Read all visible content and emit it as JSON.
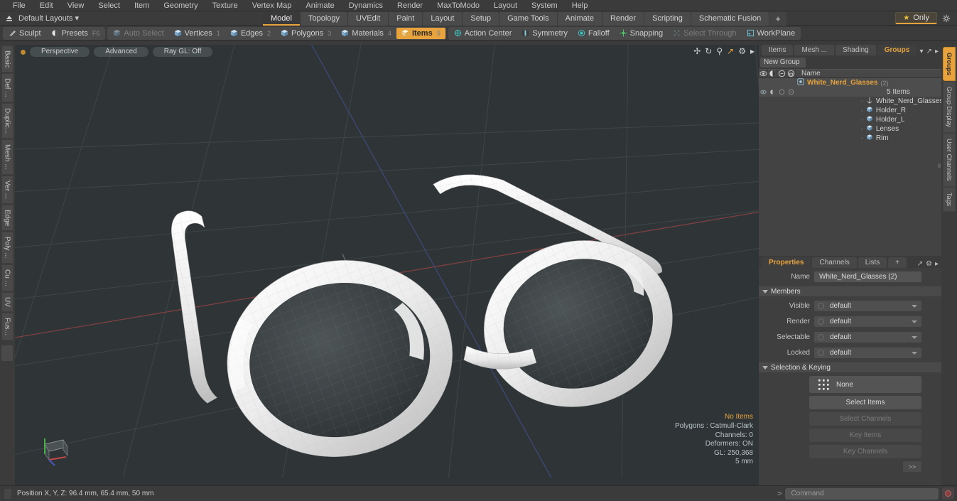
{
  "menubar": {
    "items": [
      "File",
      "Edit",
      "View",
      "Select",
      "Item",
      "Geometry",
      "Texture",
      "Vertex Map",
      "Animate",
      "Dynamics",
      "Render",
      "MaxToModo",
      "Layout",
      "System",
      "Help"
    ]
  },
  "layout_row": {
    "default_layouts_label": "Default Layouts ▾",
    "tabs": [
      {
        "label": "Model",
        "active": true
      },
      {
        "label": "Topology",
        "active": false
      },
      {
        "label": "UVEdit",
        "active": false
      },
      {
        "label": "Paint",
        "active": false
      },
      {
        "label": "Layout",
        "active": false
      },
      {
        "label": "Setup",
        "active": false
      },
      {
        "label": "Game Tools",
        "active": false
      },
      {
        "label": "Animate",
        "active": false
      },
      {
        "label": "Render",
        "active": false
      },
      {
        "label": "Scripting",
        "active": false
      },
      {
        "label": "Schematic Fusion",
        "active": false
      }
    ],
    "add_tab_label": "+",
    "only_label": "Only",
    "star_icon": "star-icon",
    "gear_icon": "gear-icon"
  },
  "mode_toolbar": {
    "group1": [
      {
        "label": "Sculpt",
        "icon": "brush-icon",
        "state": "normal"
      },
      {
        "label": "Presets",
        "icon": "sphere-icon",
        "state": "normal",
        "hotkey": "F6"
      }
    ],
    "group2": [
      {
        "label": "Auto Select",
        "icon": "cube-icon",
        "state": "dim"
      },
      {
        "label": "Vertices",
        "icon": "cube-icon",
        "state": "normal",
        "num": "1"
      },
      {
        "label": "Edges",
        "icon": "cube-icon",
        "state": "normal",
        "num": "2"
      },
      {
        "label": "Polygons",
        "icon": "cube-icon",
        "state": "normal",
        "num": "3"
      },
      {
        "label": "Materials",
        "icon": "cube-icon",
        "state": "normal",
        "num": "4"
      },
      {
        "label": "Items",
        "icon": "cube-icon",
        "state": "selected",
        "num": "5"
      }
    ],
    "group3": [
      {
        "label": "Action Center",
        "icon": "target-icon",
        "state": "normal"
      },
      {
        "label": "Symmetry",
        "icon": "symmetry-icon",
        "state": "normal"
      },
      {
        "label": "Falloff",
        "icon": "falloff-icon",
        "state": "normal"
      },
      {
        "label": "Snapping",
        "icon": "snap-icon",
        "state": "normal"
      },
      {
        "label": "Select Through",
        "icon": "selectthrough-icon",
        "state": "dim"
      },
      {
        "label": "WorkPlane",
        "icon": "workplane-icon",
        "state": "normal"
      }
    ]
  },
  "left_rail": {
    "tabs": [
      "Basic",
      "Def ...",
      "Duplic...",
      "Mesh ...",
      "Ver ...",
      "Edge",
      "Poly ...",
      "Cu ...",
      "UV",
      "Fus..."
    ]
  },
  "viewport": {
    "buttons": [
      "Perspective",
      "Advanced",
      "Ray GL: Off"
    ],
    "nav_icons": [
      "pan-icon",
      "rotate-icon",
      "zoom-icon",
      "fit-icon",
      "gear-icon",
      "play-icon"
    ],
    "stats": {
      "selection": "No Items",
      "polygons": "Polygons : Catmull-Clark",
      "channels": "Channels: 0",
      "deformers": "Deformers: ON",
      "gl": "GL: 250,368",
      "scale": "5 mm"
    },
    "colors": {
      "background": "#2f3537",
      "grid": "#3c4446",
      "x_axis": "#7a3d3d",
      "z_axis": "#3d4a7a",
      "model": "#f2f2f2",
      "lens": "#3b4042"
    }
  },
  "right_panel": {
    "tabs": [
      {
        "label": "Items",
        "active": false
      },
      {
        "label": "Mesh ...",
        "active": false
      },
      {
        "label": "Shading",
        "active": false
      },
      {
        "label": "Groups",
        "active": true
      }
    ],
    "tab_icons": [
      "chevron-down-icon",
      "expand-icon",
      "play-icon"
    ],
    "new_group_label": "New Group",
    "column_icons": [
      "eye-icon",
      "render-icon",
      "select-icon",
      "lock-icon"
    ],
    "name_column_header": "Name",
    "tree": {
      "group": {
        "name": "White_Nerd_Glasses",
        "count": "(2)",
        "items_label": "5 Items"
      },
      "children": [
        {
          "name": "White_Nerd_Glasses",
          "icon": "locator-icon"
        },
        {
          "name": "Holder_R",
          "icon": "mesh-icon"
        },
        {
          "name": "Holder_L",
          "icon": "mesh-icon"
        },
        {
          "name": "Lenses",
          "icon": "mesh-icon"
        },
        {
          "name": "Rim",
          "icon": "mesh-icon"
        }
      ]
    }
  },
  "properties": {
    "tabs": [
      {
        "label": "Properties",
        "active": true
      },
      {
        "label": "Channels",
        "active": false
      },
      {
        "label": "Lists",
        "active": false
      },
      {
        "label": "+",
        "active": false
      }
    ],
    "name_label": "Name",
    "name_value": "White_Nerd_Glasses (2)",
    "members_section": "Members",
    "members": [
      {
        "label": "Visible",
        "value": "default"
      },
      {
        "label": "Render",
        "value": "default"
      },
      {
        "label": "Selectable",
        "value": "default"
      },
      {
        "label": "Locked",
        "value": "default"
      }
    ],
    "selection_section": "Selection & Keying",
    "buttons": [
      {
        "label": "None",
        "state": "normal",
        "icon": "dotgrid-icon"
      },
      {
        "label": "Select Items",
        "state": "normal"
      },
      {
        "label": "Select Channels",
        "state": "dim"
      },
      {
        "label": "Key Items",
        "state": "dim"
      },
      {
        "label": "Key Channels",
        "state": "dim"
      }
    ],
    "more_label": ">>"
  },
  "right_rail": {
    "tabs": [
      {
        "label": "Groups",
        "active": true
      },
      {
        "label": "Group Display",
        "active": false
      },
      {
        "label": "User Channels",
        "active": false
      },
      {
        "label": "Tags",
        "active": false
      }
    ]
  },
  "status_bar": {
    "position_text": "Position X, Y, Z:  96.4 mm, 65.4 mm, 50 mm",
    "command_prompt": ">",
    "command_placeholder": "Command",
    "record_icon": "record-icon"
  }
}
